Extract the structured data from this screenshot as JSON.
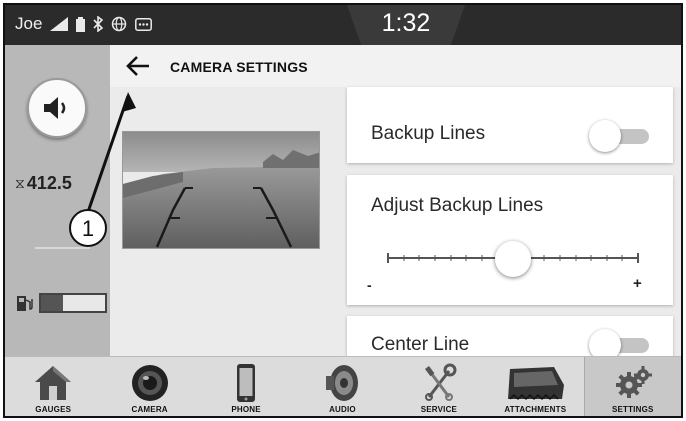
{
  "status_bar": {
    "user": "Joe",
    "time": "1:32",
    "icons": [
      "signal-icon",
      "battery-icon",
      "bluetooth-icon",
      "globe-icon",
      "message-icon"
    ]
  },
  "left_panel": {
    "hours_value": "412.5",
    "hours_icon": "hourglass-icon",
    "fuel_level": 0.35,
    "volume_icon": "speaker-icon"
  },
  "header": {
    "title": "CAMERA SETTINGS",
    "back_icon": "back-arrow-icon"
  },
  "settings": {
    "backup_lines": {
      "label": "Backup Lines",
      "enabled": false
    },
    "adjust_backup_lines": {
      "label": "Adjust Backup Lines",
      "min_label": "-",
      "max_label": "+",
      "value": 0.5
    },
    "center_line": {
      "label": "Center Line",
      "enabled": false
    }
  },
  "annotation": {
    "callout_number": "1"
  },
  "nav": {
    "items": [
      {
        "label": "GAUGES",
        "icon": "house-icon"
      },
      {
        "label": "CAMERA",
        "icon": "camera-lens-icon"
      },
      {
        "label": "PHONE",
        "icon": "phone-icon"
      },
      {
        "label": "AUDIO",
        "icon": "speaker-icon"
      },
      {
        "label": "SERVICE",
        "icon": "wrench-screwdriver-icon"
      },
      {
        "label": "ATTACHMENTS",
        "icon": "bucket-icon"
      },
      {
        "label": "SETTINGS",
        "icon": "gears-icon"
      }
    ],
    "active_index": 6
  }
}
